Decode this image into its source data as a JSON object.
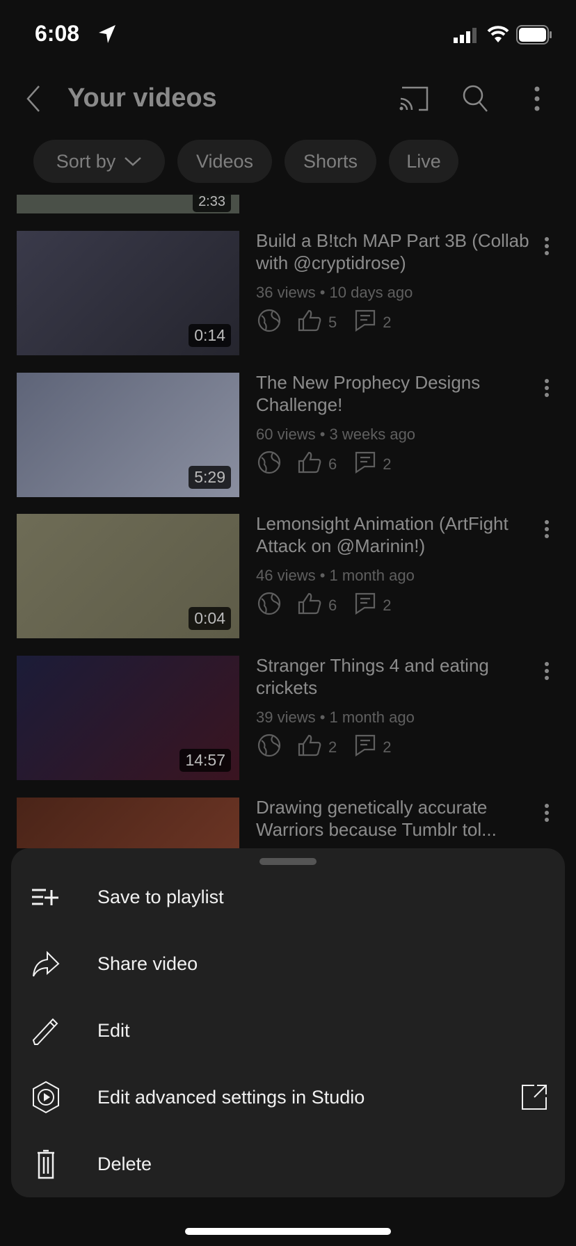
{
  "status": {
    "time": "6:08"
  },
  "header": {
    "title": "Your videos",
    "icons": [
      "back-icon",
      "cast-icon",
      "search-icon",
      "more-vert-icon"
    ]
  },
  "chips": [
    {
      "label": "Sort by"
    },
    {
      "label": "Videos"
    },
    {
      "label": "Shorts"
    },
    {
      "label": "Live"
    }
  ],
  "partial_duration": "2:33",
  "videos": [
    {
      "title": "Build a B!tch MAP Part 3B (Collab with @cryptidrose)",
      "meta": "36 views • 10 days ago",
      "likes": "5",
      "comments": "2",
      "duration": "0:14",
      "thumb": [
        "#3a3a4a",
        "#25252e"
      ]
    },
    {
      "title": "The New Prophecy Designs Challenge!",
      "meta": "60 views • 3 weeks ago",
      "likes": "6",
      "comments": "2",
      "duration": "5:29",
      "thumb": [
        "#5e6478",
        "#8a8fa0"
      ]
    },
    {
      "title": "Lemonsight Animation (ArtFight Attack on @Marinin!)",
      "meta": "46 views • 1 month ago",
      "likes": "6",
      "comments": "2",
      "duration": "0:04",
      "thumb": [
        "#6e6c56",
        "#5e5c48"
      ]
    },
    {
      "title": "Stranger Things 4 and eating crickets",
      "meta": "39 views • 1 month ago",
      "likes": "2",
      "comments": "2",
      "duration": "14:57",
      "thumb": [
        "#1b1c38",
        "#3a1420"
      ]
    },
    {
      "title": "Drawing genetically accurate Warriors because Tumblr tol...",
      "thumb": [
        "#4a2418",
        "#6a3424"
      ]
    }
  ],
  "sheet": {
    "items": [
      {
        "label": "Save to playlist",
        "icon": "playlist-add-icon"
      },
      {
        "label": "Share video",
        "icon": "share-icon"
      },
      {
        "label": "Edit",
        "icon": "pencil-icon"
      },
      {
        "label": "Edit advanced settings in Studio",
        "icon": "studio-icon",
        "trailing": "open-external-icon"
      },
      {
        "label": "Delete",
        "icon": "trash-icon"
      }
    ]
  }
}
